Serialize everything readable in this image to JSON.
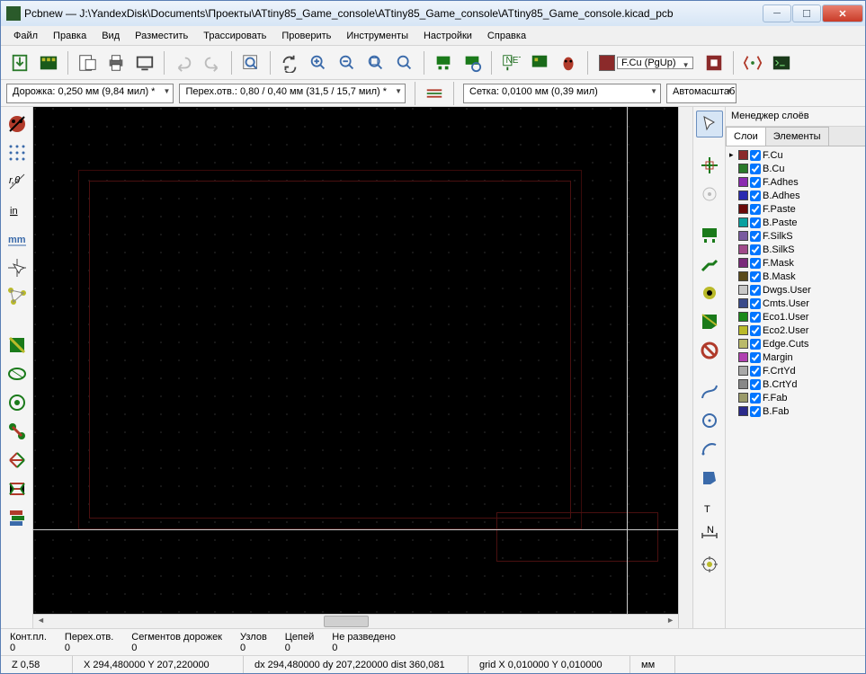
{
  "title": "Pcbnew — J:\\YandexDisk\\Documents\\Проекты\\ATtiny85_Game_console\\ATtiny85_Game_console\\ATtiny85_Game_console.kicad_pcb",
  "menu": {
    "file": "Файл",
    "edit": "Правка",
    "view": "Вид",
    "place": "Разместить",
    "route": "Трассировать",
    "inspect": "Проверить",
    "tools": "Инструменты",
    "prefs": "Настройки",
    "help": "Справка"
  },
  "toolbar": {
    "layer_label": "F.Cu (PgUp)"
  },
  "tb2": {
    "track": "Дорожка: 0,250 мм (9,84 мил) *",
    "via": "Перех.отв.: 0,80 / 0,40 мм (31,5 / 15,7 мил) *",
    "grid": "Сетка: 0,0100 мм (0,39 мил)",
    "zoom": "Автомасштаб"
  },
  "layerpanel": {
    "title": "Менеджер слоёв",
    "tab1": "Слои",
    "tab2": "Элементы"
  },
  "layers": [
    {
      "c": "#8b2a2a",
      "n": "F.Cu",
      "a": true
    },
    {
      "c": "#2a7a2a",
      "n": "B.Cu"
    },
    {
      "c": "#8a2ab0",
      "n": "F.Adhes"
    },
    {
      "c": "#2a2ab0",
      "n": "B.Adhes"
    },
    {
      "c": "#6a0a0a",
      "n": "F.Paste"
    },
    {
      "c": "#0aa0a0",
      "n": "B.Paste"
    },
    {
      "c": "#7a5aa0",
      "n": "F.SilkS"
    },
    {
      "c": "#a04a8a",
      "n": "B.SilkS"
    },
    {
      "c": "#7a2a7a",
      "n": "F.Mask"
    },
    {
      "c": "#5a4a1a",
      "n": "B.Mask"
    },
    {
      "c": "#c8c8c8",
      "n": "Dwgs.User"
    },
    {
      "c": "#3a4a8a",
      "n": "Cmts.User"
    },
    {
      "c": "#1a8a1a",
      "n": "Eco1.User"
    },
    {
      "c": "#baba2a",
      "n": "Eco2.User"
    },
    {
      "c": "#baba6a",
      "n": "Edge.Cuts"
    },
    {
      "c": "#b040b0",
      "n": "Margin"
    },
    {
      "c": "#a8a8a8",
      "n": "F.CrtYd"
    },
    {
      "c": "#888888",
      "n": "B.CrtYd"
    },
    {
      "c": "#9a9a6a",
      "n": "F.Fab"
    },
    {
      "c": "#2a2a8a",
      "n": "B.Fab"
    }
  ],
  "status1": {
    "pads_l": "Конт.пл.",
    "pads_v": "0",
    "vias_l": "Перех.отв.",
    "vias_v": "0",
    "seg_l": "Сегментов дорожек",
    "seg_v": "0",
    "nodes_l": "Узлов",
    "nodes_v": "0",
    "nets_l": "Цепей",
    "nets_v": "0",
    "unr_l": "Не разведено",
    "unr_v": "0"
  },
  "status2": {
    "z": "Z 0,58",
    "xy": "X 294,480000  Y 207,220000",
    "dxy": "dx 294,480000  dy 207,220000  dist 360,081",
    "gridxy": "grid X 0,010000  Y 0,010000",
    "unit": "мм"
  }
}
